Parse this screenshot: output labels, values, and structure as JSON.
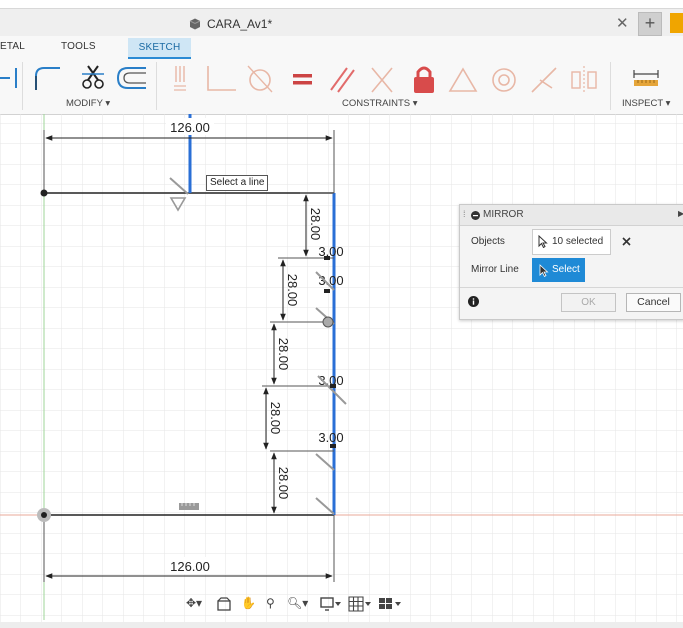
{
  "window": {
    "title": "CARA_Av1*",
    "close_glyph": "✕",
    "new_tab_glyph": "+"
  },
  "ribbon": {
    "tabs": [
      "ETAL",
      "TOOLS",
      "SKETCH"
    ],
    "groups": {
      "modify": "MODIFY ▾",
      "constraints": "CONSTRAINTS ▾",
      "inspect": "INSPECT ▾"
    }
  },
  "sketch": {
    "dimensions": {
      "top_width": "126.00",
      "bottom_width": "126.00",
      "depths": [
        "28.00",
        "28.00",
        "28.00",
        "28.00",
        "28.00"
      ],
      "gaps": [
        "3.00",
        "3.00",
        "3.00",
        "3.00"
      ]
    },
    "tooltip": "Select a line"
  },
  "mirror_panel": {
    "title": "MIRROR",
    "objects_label": "Objects",
    "objects_value": "10 selected",
    "mirror_line_label": "Mirror Line",
    "select_label": "Select",
    "ok_label": "OK",
    "cancel_label": "Cancel"
  },
  "colors": {
    "accent": "#1f8ad6",
    "sketch_line": "#222222",
    "selected_line": "#2a6fd6",
    "constraint_red": "#e26b6b",
    "origin_x_axis": "#e9a89a",
    "origin_y_axis": "#9fd59a"
  },
  "icons": {
    "ribbon": [
      "fillet-icon",
      "trim-icon",
      "offset-icon",
      "pattern-icon",
      "coincident-icon",
      "tangent-icon",
      "equal-icon",
      "parallel-icon",
      "perpendicular-icon",
      "fix-icon",
      "triangle-icon",
      "concentric-icon",
      "midpoint-icon",
      "symmetry-icon",
      "measure-icon"
    ],
    "navbar": [
      "orbit-icon",
      "look-at-icon",
      "pan-icon",
      "zoom-icon",
      "zoom-window-icon",
      "display-settings-icon",
      "grid-icon",
      "viewports-icon"
    ]
  }
}
